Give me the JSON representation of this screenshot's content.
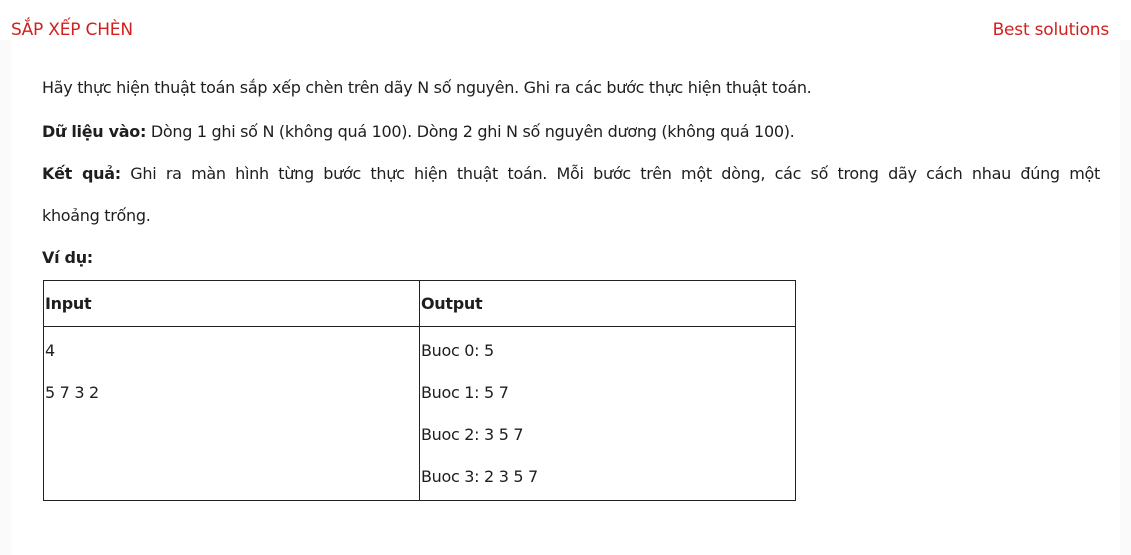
{
  "header": {
    "title": "SẮP XẾP CHÈN",
    "best_solutions": "Best solutions"
  },
  "problem": {
    "description": "Hãy thực hiện thuật toán sắp xếp chèn trên dãy N số nguyên. Ghi ra các bước thực hiện thuật toán.",
    "input_label": "Dữ liệu vào:",
    "input_text": "Dòng 1 ghi số N (không quá 100). Dòng 2 ghi N số nguyên dương (không quá 100).",
    "output_label": "Kết quả:",
    "output_text_line1": "Ghi ra màn hình từng bước thực hiện thuật toán. Mỗi bước trên một dòng, các số trong dãy cách nhau đúng một",
    "output_text_line2": "khoảng trống.",
    "example_label": "Ví dụ:"
  },
  "example_table": {
    "headers": [
      "Input",
      "Output"
    ],
    "input_lines": [
      "4",
      "5 7 3 2"
    ],
    "output_lines": [
      "Buoc 0: 5",
      "Buoc 1: 5 7",
      "Buoc 2: 3 5 7",
      "Buoc 3: 2 3 5 7"
    ]
  },
  "colors": {
    "accent": "#d21f1f",
    "text": "#1e1e1e"
  }
}
